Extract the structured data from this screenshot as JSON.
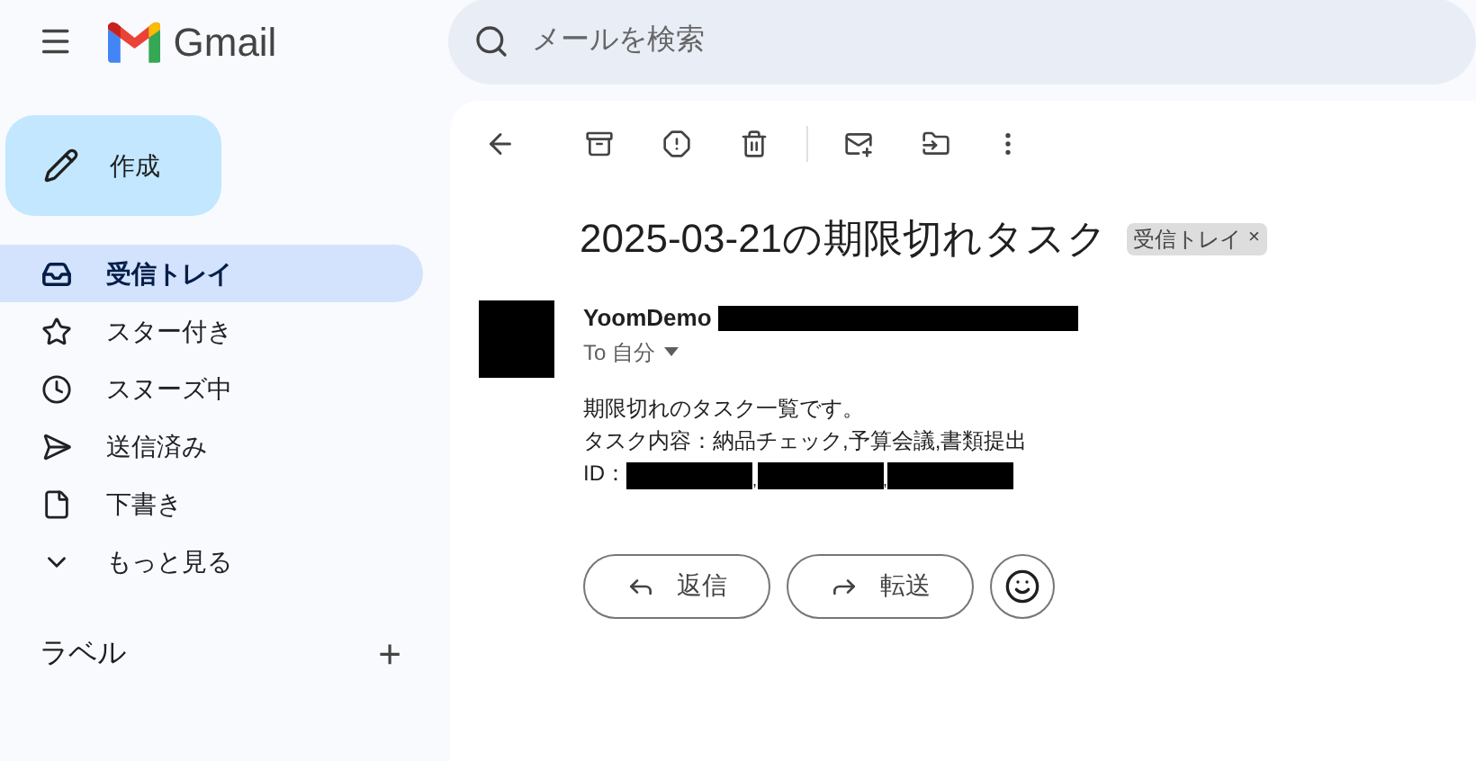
{
  "header": {
    "logo_text": "Gmail",
    "search": {
      "placeholder": "メールを検索"
    }
  },
  "compose": {
    "label": "作成"
  },
  "sidebar": {
    "items": [
      {
        "label": "受信トレイ",
        "kind": "inbox",
        "selected": true
      },
      {
        "label": "スター付き",
        "kind": "star",
        "selected": false
      },
      {
        "label": "スヌーズ中",
        "kind": "clock",
        "selected": false
      },
      {
        "label": "送信済み",
        "kind": "send",
        "selected": false
      },
      {
        "label": "下書き",
        "kind": "file",
        "selected": false
      },
      {
        "label": "もっと見る",
        "kind": "chevron",
        "selected": false
      }
    ],
    "labels_title": "ラベル",
    "add": "+"
  },
  "message": {
    "subject": "2025-03-21の期限切れタスク",
    "tag": {
      "label": "受信トレイ",
      "close": "×"
    },
    "sender": {
      "name": "YoomDemo",
      "redacted_address": true
    },
    "to": "To 自分",
    "body": [
      "期限切れのタスク一覧です。",
      "タスク内容：納品チェック,予算会議,書類提出"
    ],
    "id_line": {
      "label": "ID：",
      "separator": ",",
      "ids": [
        {
          "kind": "redacted"
        },
        {
          "kind": "redacted"
        },
        {
          "kind": "redacted"
        }
      ]
    },
    "actions": [
      {
        "label": "返信",
        "kind": "reply"
      },
      {
        "label": "転送",
        "kind": "forward"
      }
    ]
  }
}
